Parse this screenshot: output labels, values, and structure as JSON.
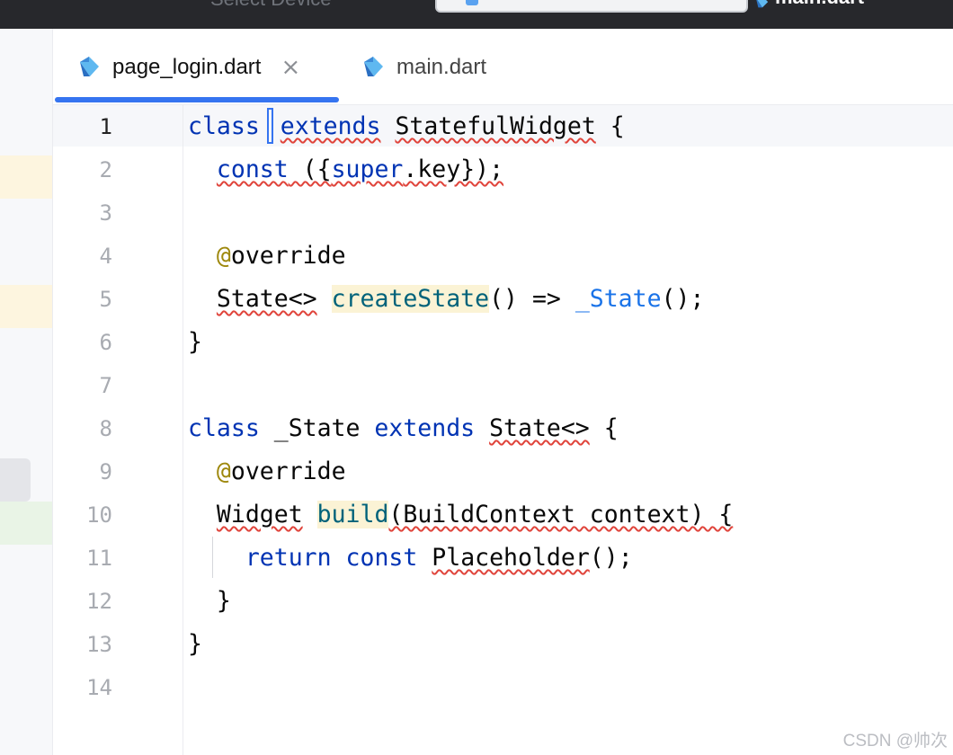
{
  "topbar": {
    "device_label": "Select Device",
    "run_config": "main.dart"
  },
  "tabs": [
    {
      "label": "page_login.dart",
      "active": true,
      "close_glyph": "×"
    },
    {
      "label": "main.dart",
      "active": false
    }
  ],
  "colors": {
    "accent": "#3574f0",
    "keyword": "#0033b3",
    "annotation": "#9e880d",
    "function": "#00627a",
    "error_underline": "#e0443b",
    "highlight": "#fbf3d5"
  },
  "editor": {
    "current_line": 1,
    "line_numbers": [
      "1",
      "2",
      "3",
      "4",
      "5",
      "6",
      "7",
      "8",
      "9",
      "10",
      "11",
      "12",
      "13",
      "14"
    ],
    "code": {
      "l1": {
        "kw1": "class",
        "kw2": "extends",
        "type": "StatefulWidget",
        "tail": " {"
      },
      "l2": {
        "kw": "const",
        "open": " ({",
        "super": "super",
        "rest": ".key});"
      },
      "l4": {
        "at": "@",
        "name": "override"
      },
      "l5": {
        "type": "State<>",
        "space": " ",
        "fn": "createState",
        "mid": "() => ",
        "priv": "_State",
        "tail": "();"
      },
      "l6": {
        "text": "}"
      },
      "l8": {
        "kw1": "class",
        "name": " _State ",
        "kw2": "extends",
        "space": " ",
        "type": "State<>",
        "tail": " {"
      },
      "l9": {
        "at": "@",
        "name": "override"
      },
      "l10": {
        "type": "Widget",
        "space": " ",
        "fn": "build",
        "rest": "(BuildContext context) {"
      },
      "l11": {
        "kw1": "return",
        "kw2": "const",
        "type": "Placeholder",
        "tail": "();"
      },
      "l12": {
        "text": "}"
      },
      "l13": {
        "text": "}"
      }
    }
  },
  "watermark": "CSDN @帅次",
  "icons": {
    "tab1": "dart-file-icon",
    "tab2": "dart-file-icon",
    "run": "dart-file-icon"
  }
}
